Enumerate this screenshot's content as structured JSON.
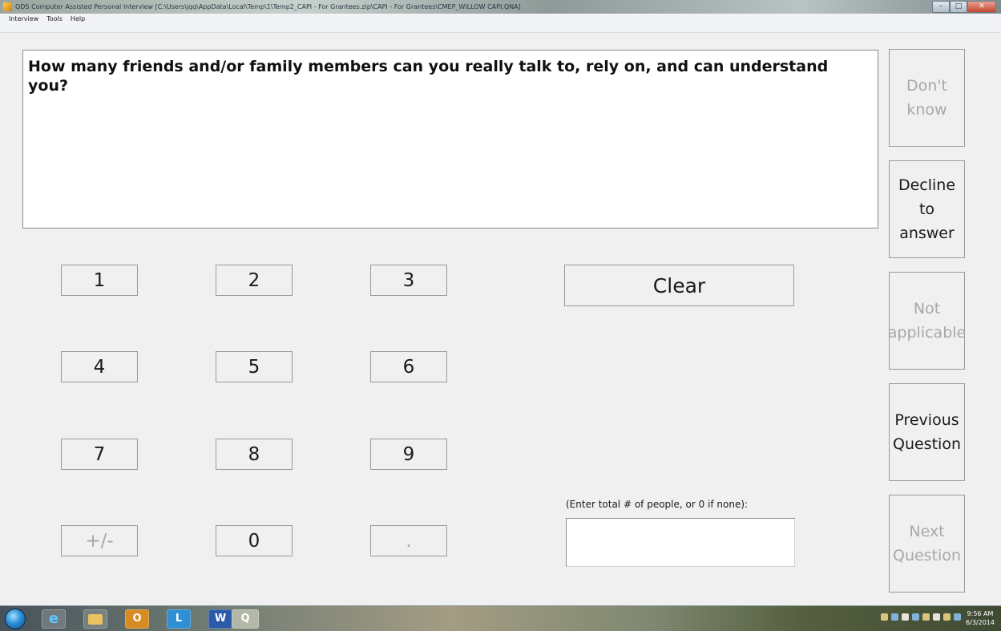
{
  "window": {
    "title": "QDS Computer Assisted Personal Interview [C:\\Users\\jqq\\AppData\\Local\\Temp\\1\\Temp2_CAPI - For Grantees.zip\\CAPI - For Grantees\\CMEP_WILLOW CAPI.QNA]",
    "controls": {
      "minimize": "–",
      "maximize": "□",
      "close": "✕"
    }
  },
  "menu": [
    "Interview",
    "Tools",
    "Help"
  ],
  "question": {
    "text": "How many friends and/or family members can you really talk to, rely on, and can understand you?"
  },
  "keypad": {
    "k1": "1",
    "k2": "2",
    "k3": "3",
    "k4": "4",
    "k5": "5",
    "k6": "6",
    "k7": "7",
    "k8": "8",
    "k9": "9",
    "sign": "+/-",
    "k0": "0",
    "decimal": "."
  },
  "clear_label": "Clear",
  "answer": {
    "hint": "(Enter total # of people, or 0 if none):",
    "value": ""
  },
  "side_buttons": {
    "dont_know": "Don't know",
    "decline": "Decline to answer",
    "not_applicable": "Not applicable",
    "previous": "Previous Question",
    "next": "Next Question"
  },
  "taskbar": {
    "outlook": "O",
    "lync": "L",
    "word": "W",
    "app": "Q",
    "clock_time": "9:56 AM",
    "clock_date": "6/3/2014"
  },
  "icons": {
    "app": "app-icon",
    "start": "windows-start-icon",
    "ie": "internet-explorer-icon",
    "folder": "folder-icon",
    "outlook": "outlook-icon",
    "lync": "lync-icon",
    "word": "word-icon"
  }
}
